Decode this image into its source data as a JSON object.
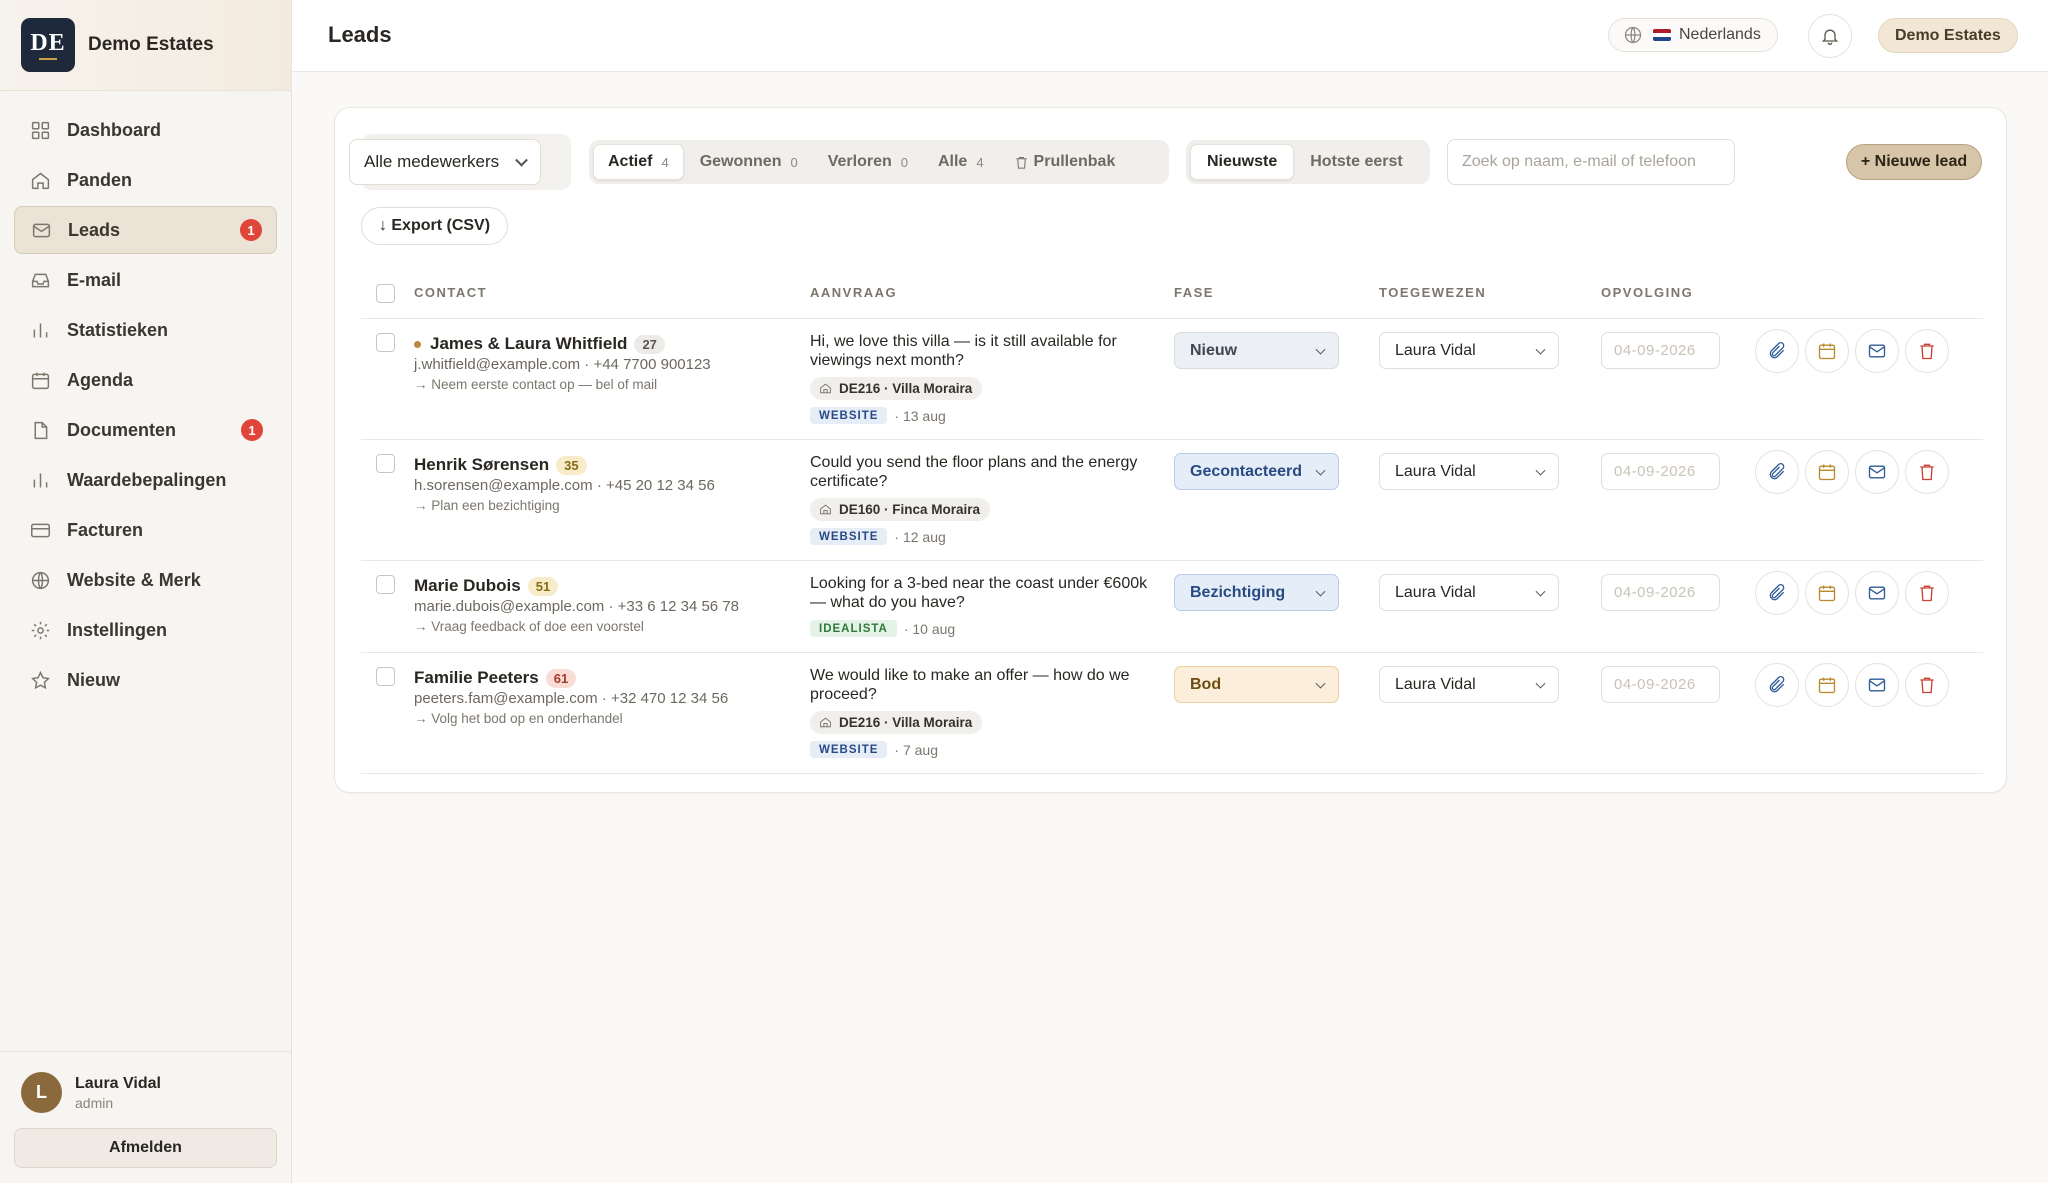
{
  "sidebar": {
    "logo_text": "DE",
    "brand_name": "Demo Estates",
    "items": [
      {
        "label": "Dashboard",
        "icon": "grid-icon"
      },
      {
        "label": "Panden",
        "icon": "home-icon"
      },
      {
        "label": "Leads",
        "icon": "mail-icon",
        "badge": "1",
        "active": true
      },
      {
        "label": "E-mail",
        "icon": "inbox-icon"
      },
      {
        "label": "Statistieken",
        "icon": "bar-chart-icon"
      },
      {
        "label": "Agenda",
        "icon": "calendar-icon"
      },
      {
        "label": "Documenten",
        "icon": "document-icon",
        "badge": "1"
      },
      {
        "label": "Waardebepalingen",
        "icon": "bar-chart-icon"
      },
      {
        "label": "Facturen",
        "icon": "credit-card-icon"
      },
      {
        "label": "Website & Merk",
        "icon": "globe-icon"
      },
      {
        "label": "Instellingen",
        "icon": "gear-icon"
      },
      {
        "label": "Nieuw",
        "icon": "star-icon"
      }
    ],
    "user": {
      "initial": "L",
      "name": "Laura Vidal",
      "role": "admin"
    },
    "logout_label": "Afmelden"
  },
  "header": {
    "title": "Leads",
    "language": "Nederlands",
    "org": "Demo Estates"
  },
  "toolbar": {
    "staff_filter": "Alle medewerkers",
    "tabs": [
      {
        "label": "Actief",
        "count": "4",
        "active": true
      },
      {
        "label": "Gewonnen",
        "count": "0"
      },
      {
        "label": "Verloren",
        "count": "0"
      },
      {
        "label": "Alle",
        "count": "4"
      },
      {
        "label": "Prullenbak",
        "count": ""
      }
    ],
    "sort": [
      {
        "label": "Nieuwste",
        "active": true
      },
      {
        "label": "Hotste eerst"
      }
    ],
    "search_placeholder": "Zoek op naam, e-mail of telefoon",
    "new_lead_label": "+ Nieuwe lead",
    "export_label": "↓ Export (CSV)"
  },
  "table": {
    "headers": {
      "contact": "CONTACT",
      "request": "AANVRAAG",
      "phase": "FASE",
      "assigned": "TOEGEWEZEN",
      "followup": "OPVOLGING"
    },
    "rows": [
      {
        "name": "James & Laura Whitfield",
        "score": "27",
        "score_tone": "grey",
        "unread": true,
        "email": "j.whitfield@example.com · +44 7700 900123",
        "next": "→ Neem eerste contact op — bel of mail",
        "message": "Hi, we love this villa — is it still available for viewings next month?",
        "property": "DE216 · Villa Moraira",
        "source": "WEBSITE",
        "date": "· 13 aug",
        "phase": "Nieuw",
        "phase_tone": "grey",
        "assignee": "Laura Vidal",
        "followup_date": "04-09-2026"
      },
      {
        "name": "Henrik Sørensen",
        "score": "35",
        "score_tone": "yellow",
        "unread": false,
        "email": "h.sorensen@example.com · +45 20 12 34 56",
        "next": "→ Plan een bezichtiging",
        "message": "Could you send the floor plans and the energy certificate?",
        "property": "DE160 · Finca Moraira",
        "source": "WEBSITE",
        "date": "· 12 aug",
        "phase": "Gecontacteerd",
        "phase_tone": "blue",
        "assignee": "Laura Vidal",
        "followup_date": "04-09-2026"
      },
      {
        "name": "Marie Dubois",
        "score": "51",
        "score_tone": "yellow",
        "unread": false,
        "email": "marie.dubois@example.com · +33 6 12 34 56 78",
        "next": "→ Vraag feedback of doe een voorstel",
        "message": "Looking for a 3-bed near the coast under €600k — what do you have?",
        "property": "",
        "source": "IDEALISTA",
        "date": "· 10 aug",
        "phase": "Bezichtiging",
        "phase_tone": "blue",
        "assignee": "Laura Vidal",
        "followup_date": "04-09-2026"
      },
      {
        "name": "Familie Peeters",
        "score": "61",
        "score_tone": "red",
        "unread": false,
        "email": "peeters.fam@example.com · +32 470 12 34 56",
        "next": "→ Volg het bod op en onderhandel",
        "message": "We would like to make an offer — how do we proceed?",
        "property": "DE216 · Villa Moraira",
        "source": "WEBSITE",
        "date": "· 7 aug",
        "phase": "Bod",
        "phase_tone": "orange",
        "assignee": "Laura Vidal",
        "followup_date": "04-09-2026"
      }
    ]
  },
  "colors": {
    "accent": "#d6c5a8",
    "badge": "#e0453a",
    "navy": "#1e2a3b"
  }
}
